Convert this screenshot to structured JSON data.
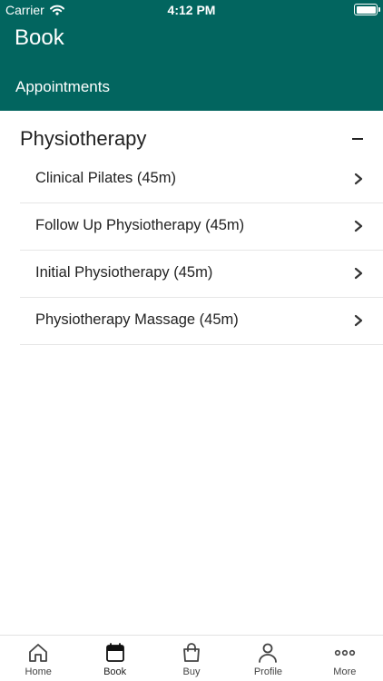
{
  "status": {
    "carrier": "Carrier",
    "time": "4:12 PM"
  },
  "header": {
    "title": "Book",
    "subtitle": "Appointments",
    "color": "#02655f"
  },
  "section": {
    "title": "Physiotherapy"
  },
  "items": [
    {
      "label": "Clinical Pilates (45m)"
    },
    {
      "label": "Follow Up Physiotherapy (45m)"
    },
    {
      "label": "Initial Physiotherapy (45m)"
    },
    {
      "label": "Physiotherapy Massage (45m)"
    }
  ],
  "tabs": [
    {
      "label": "Home",
      "icon": "home-icon"
    },
    {
      "label": "Book",
      "icon": "calendar-icon",
      "active": true
    },
    {
      "label": "Buy",
      "icon": "bag-icon"
    },
    {
      "label": "Profile",
      "icon": "person-icon"
    },
    {
      "label": "More",
      "icon": "more-icon"
    }
  ]
}
